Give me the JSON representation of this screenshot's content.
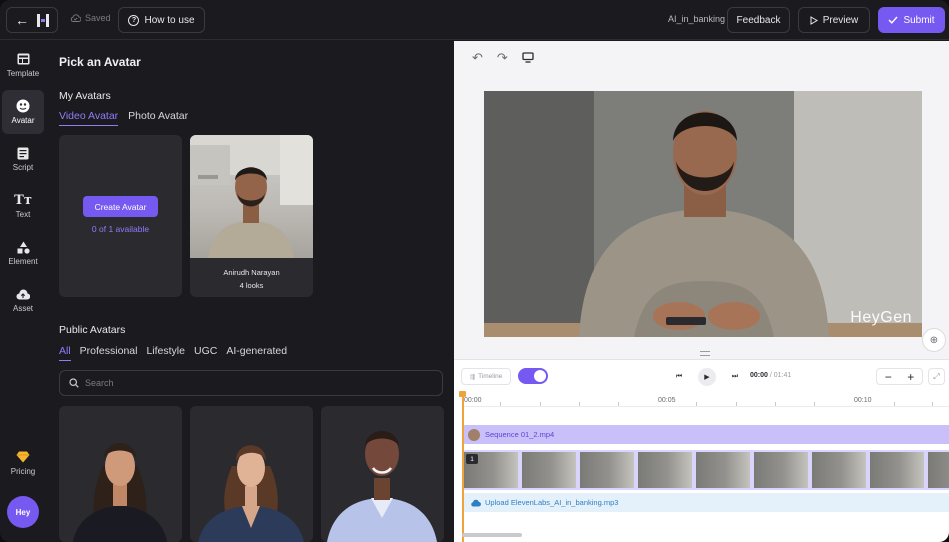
{
  "topbar": {
    "saved_label": "Saved",
    "how_to_use_label": "How to use",
    "project_name": "AI_in_banking",
    "feedback_label": "Feedback",
    "preview_label": "Preview",
    "submit_label": "Submit"
  },
  "nav": {
    "items": [
      {
        "label": "Template",
        "icon": "template-icon"
      },
      {
        "label": "Avatar",
        "icon": "avatar-icon"
      },
      {
        "label": "Script",
        "icon": "script-icon"
      },
      {
        "label": "Text",
        "icon": "text-icon"
      },
      {
        "label": "Element",
        "icon": "element-icon"
      },
      {
        "label": "Asset",
        "icon": "asset-icon"
      }
    ],
    "pricing_label": "Pricing",
    "profile_label": "Hey"
  },
  "avatar_panel": {
    "title": "Pick an Avatar",
    "my_avatars_title": "My Avatars",
    "my_tabs": [
      "Video Avatar",
      "Photo Avatar"
    ],
    "create_button": "Create Avatar",
    "available_text": "0 of 1 available",
    "avatar_name": "Anirudh Narayan",
    "avatar_looks": "4 looks",
    "public_title": "Public Avatars",
    "public_tabs": [
      "All",
      "Professional",
      "Lifestyle",
      "UGC",
      "AI-generated"
    ],
    "search_placeholder": "Search"
  },
  "canvas": {
    "watermark": "HeyGen"
  },
  "timeline": {
    "timeline_chip": "Timeline",
    "current_time": "00:00",
    "total_time": "/ 01:41",
    "ruler_labels": [
      "00:00",
      "00:05",
      "00:10"
    ],
    "sequence_label": "Sequence 01_2.mp4",
    "scene_number": "1",
    "audio_label": "Upload ElevenLabs_AI_in_banking.mp3"
  },
  "colors": {
    "accent": "#7559f0",
    "accent_light": "#8f7cf7",
    "playhead": "#f0a23b",
    "audio_text": "#2f7fc4"
  }
}
